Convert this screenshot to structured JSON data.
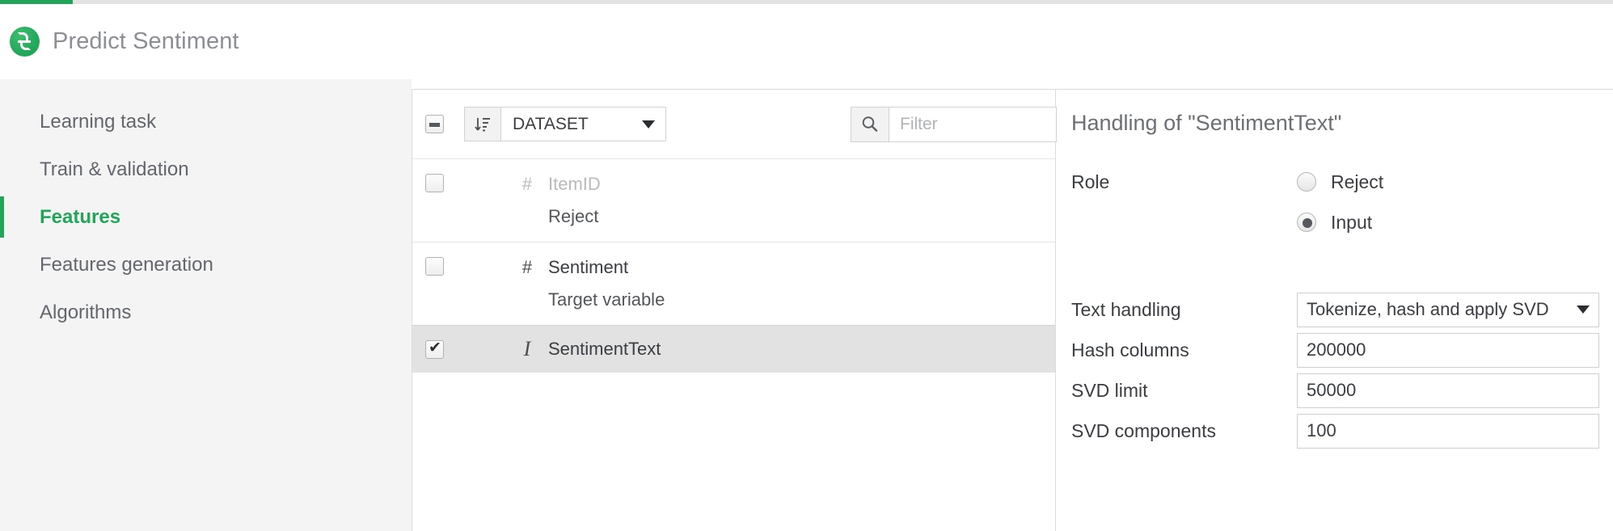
{
  "progress": {
    "percent": 4.5
  },
  "header": {
    "logo_icon": "app-logo-icon",
    "title": "Predict Sentiment"
  },
  "sidebar": {
    "items": [
      {
        "label": "Learning task",
        "active": false
      },
      {
        "label": "Train & validation",
        "active": false
      },
      {
        "label": "Features",
        "active": true
      },
      {
        "label": "Features generation",
        "active": false
      },
      {
        "label": "Algorithms",
        "active": false
      }
    ]
  },
  "toolbar": {
    "select_all_state": "indeterminate",
    "sort_icon": "sort-descending-icon",
    "group_by_label": "DATASET",
    "group_by_caret": "chevron-down-icon",
    "search_icon": "search-icon",
    "search_value": "",
    "search_placeholder": "Filter"
  },
  "features": [
    {
      "checked": false,
      "type_icon": "#",
      "type_name": "numeric-type-icon",
      "name": "ItemID",
      "muted": true,
      "subtitle": "Reject",
      "selected": false
    },
    {
      "checked": false,
      "type_icon": "#",
      "type_name": "numeric-type-icon",
      "name": "Sentiment",
      "muted": false,
      "subtitle": "Target variable",
      "selected": false
    },
    {
      "checked": true,
      "type_icon": "I",
      "type_name": "text-type-icon",
      "name": "SentimentText",
      "muted": false,
      "subtitle": "",
      "selected": true
    }
  ],
  "detail": {
    "title": "Handling of \"SentimentText\"",
    "role_label": "Role",
    "role_options": [
      {
        "label": "Reject",
        "selected": false
      },
      {
        "label": "Input",
        "selected": true
      }
    ],
    "fields": [
      {
        "label": "Text handling",
        "value": "Tokenize, hash and apply SVD",
        "kind": "select"
      },
      {
        "label": "Hash columns",
        "value": "200000",
        "kind": "input"
      },
      {
        "label": "SVD limit",
        "value": "50000",
        "kind": "input"
      },
      {
        "label": "SVD components",
        "value": "100",
        "kind": "input"
      }
    ]
  },
  "colors": {
    "accent_green": "#22a559",
    "text_dark": "#3a3d41",
    "text_muted": "#b8babd",
    "selected_row": "#e2e2e2"
  }
}
